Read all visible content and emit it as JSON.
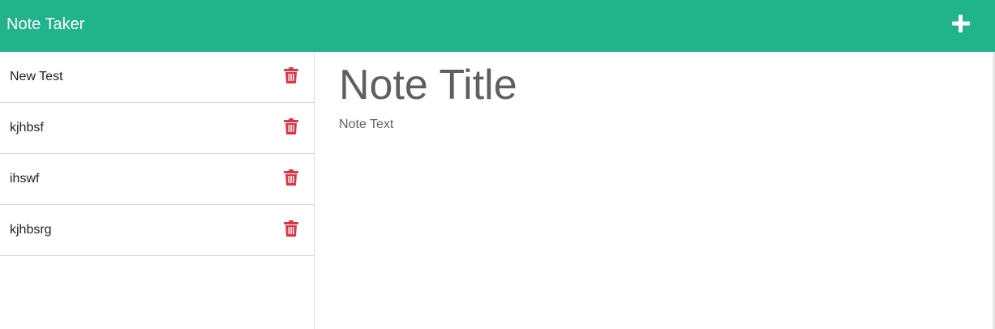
{
  "app": {
    "title": "Note Taker",
    "accent_color": "#20b38c",
    "danger_color": "#dc3545"
  },
  "toolbar": {
    "add_icon": "plus-icon"
  },
  "notes": [
    {
      "title": "New Test",
      "delete_icon": "trash-icon"
    },
    {
      "title": "kjhbsf",
      "delete_icon": "trash-icon"
    },
    {
      "title": "ihswf",
      "delete_icon": "trash-icon"
    },
    {
      "title": "kjhbsrg",
      "delete_icon": "trash-icon"
    }
  ],
  "editor": {
    "title_value": "",
    "title_placeholder": "Note Title",
    "text_value": "",
    "text_placeholder": "Note Text"
  }
}
